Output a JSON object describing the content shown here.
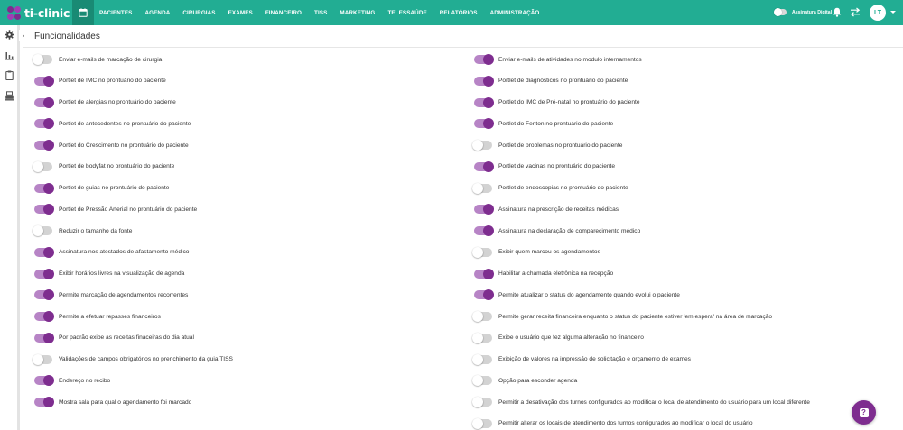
{
  "brand": {
    "name": "ti-clinic"
  },
  "nav": {
    "items": [
      "PACIENTES",
      "AGENDA",
      "CIRURGIAS",
      "EXAMES",
      "FINANCEIRO",
      "TISS",
      "MARKETING",
      "TELESSAÚDE",
      "RELATÓRIOS",
      "ADMINISTRAÇÃO"
    ]
  },
  "header": {
    "signature_label": "Assinatura Digital",
    "avatar_initials": "LT"
  },
  "page": {
    "title": "Funcionalidades"
  },
  "colors": {
    "accent": "#22ad93",
    "toggle_on": "#7e2d8f",
    "toggle_track_on": "#b784c6",
    "toggle_track_off": "#d3d3d3"
  },
  "options_left": [
    {
      "label": "Enviar e-mails de marcação de cirurgia",
      "on": false
    },
    {
      "label": "Portlet de IMC no prontuário do paciente",
      "on": true
    },
    {
      "label": "Portlet de alergias no prontuário do paciente",
      "on": true
    },
    {
      "label": "Portlet de antecedentes no prontuário do paciente",
      "on": true
    },
    {
      "label": "Portlet do Crescimento no prontuário do paciente",
      "on": true
    },
    {
      "label": "Portlet de bodyfat no prontuário do paciente",
      "on": false
    },
    {
      "label": "Portlet de guias no prontuário do paciente",
      "on": true
    },
    {
      "label": "Portlet de Pressão Arterial no prontuário do paciente",
      "on": true
    },
    {
      "label": "Reduzir o tamanho da fonte",
      "on": false
    },
    {
      "label": "Assinatura nos atestados de afastamento médico",
      "on": true
    },
    {
      "label": "Exibir horários livres na visualização de agenda",
      "on": true
    },
    {
      "label": "Permite marcação de agendamentos recorrentes",
      "on": true
    },
    {
      "label": "Permite a efetuar repasses financeiros",
      "on": true
    },
    {
      "label": "Por padrão exibe as receitas finaceiras do dia atual",
      "on": true
    },
    {
      "label": "Validações de campos obrigatórios no prenchimento da guia TISS",
      "on": false
    },
    {
      "label": "Endereço no recibo",
      "on": true
    },
    {
      "label": "Mostra sala para qual o agendamento foi marcado",
      "on": true
    }
  ],
  "options_right": [
    {
      "label": "Enviar e-mails de atividades no modulo internamentos",
      "on": true
    },
    {
      "label": "Portlet de diagnósticos no prontuário do paciente",
      "on": true
    },
    {
      "label": "Portlet do IMC de Pré-natal no prontuário do paciente",
      "on": true
    },
    {
      "label": "Portlet do Fenton no prontuário do paciente",
      "on": true
    },
    {
      "label": "Portlet de problemas no prontuário do paciente",
      "on": false
    },
    {
      "label": "Portlet de vacinas no prontuário do paciente",
      "on": true
    },
    {
      "label": "Portlet de endoscopias no prontuário do paciente",
      "on": false
    },
    {
      "label": "Assinatura na prescrição de receitas médicas",
      "on": true
    },
    {
      "label": "Assinatura na declaração de comparecimento médico",
      "on": true
    },
    {
      "label": "Exibir quem marcou os agendamentos",
      "on": false
    },
    {
      "label": "Habilitar a chamada eletrônica na recepção",
      "on": true
    },
    {
      "label": "Permite atualizar o status do agendamento quando evolui o paciente",
      "on": true
    },
    {
      "label": "Permite gerar receita financeira enquanto o status do paciente estiver 'em espera' na área de marcação",
      "on": false
    },
    {
      "label": "Exibe o usuário que fez alguma alteração no financeiro",
      "on": false
    },
    {
      "label": "Exibição de valores na impressão de solicitação e orçamento de exames",
      "on": false
    },
    {
      "label": "Opção para esconder agenda",
      "on": false
    },
    {
      "label": "Permitir a desativação dos turnos configurados ao modificar o local de atendimento do usuário para um local diferente",
      "on": false
    },
    {
      "label": "Permitir alterar os locais de atendimento dos turnos configurados ao modificar o local do usuário",
      "on": false
    }
  ]
}
